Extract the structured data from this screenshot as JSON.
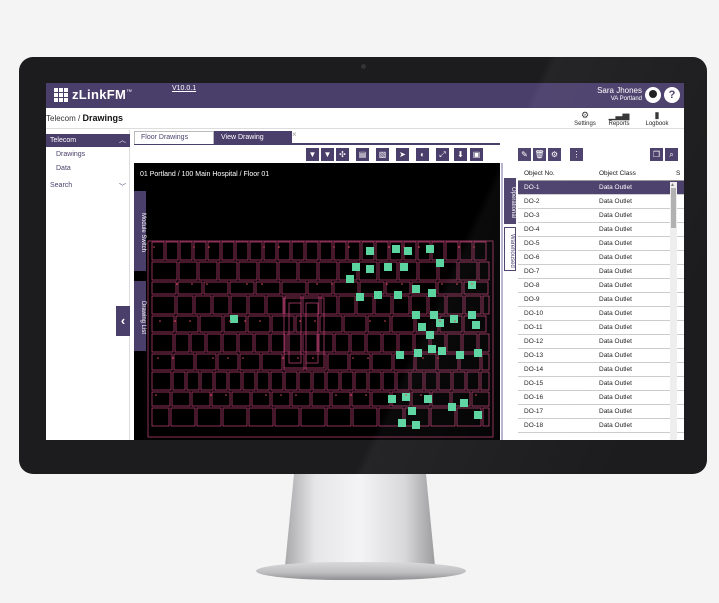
{
  "app": {
    "name": "zLinkFM",
    "trademark": "™",
    "version": "V10.0.1"
  },
  "user": {
    "name": "Sara Jhones",
    "location": "VA Portland",
    "help_glyph": "?"
  },
  "breadcrumb": {
    "parent": "Telecom",
    "separator": " / ",
    "current": "Drawings"
  },
  "toolbar": {
    "settings_label": "Settings",
    "reports_label": "Reports",
    "logbook_label": "Logbook"
  },
  "sidebar": {
    "section": "Telecom",
    "items": [
      {
        "label": "Drawings"
      },
      {
        "label": "Data"
      }
    ],
    "search_label": "Search"
  },
  "tabs": [
    {
      "label": "Floor Drawings"
    },
    {
      "label": "View Drawing"
    }
  ],
  "drawing": {
    "title": "01 Portland / 100 Main Hospital / Floor 01",
    "side_tab_1": "Module Switch",
    "side_tab_2": "Drawing List",
    "colors": {
      "background": "#000000",
      "walls": "#c8437a",
      "outlets": "#5bd4a0"
    }
  },
  "right_panel": {
    "vtab_operational": "Operational",
    "vtab_warehoused": "Warehoused",
    "columns": [
      "Object No.",
      "Object Class",
      "S"
    ],
    "rows": [
      {
        "no": "DO-1",
        "cls": "Data Outlet"
      },
      {
        "no": "DO-2",
        "cls": "Data Outlet"
      },
      {
        "no": "DO-3",
        "cls": "Data Outlet"
      },
      {
        "no": "DO-4",
        "cls": "Data Outlet"
      },
      {
        "no": "DO-5",
        "cls": "Data Outlet"
      },
      {
        "no": "DO-6",
        "cls": "Data Outlet"
      },
      {
        "no": "DO-7",
        "cls": "Data Outlet"
      },
      {
        "no": "DO-8",
        "cls": "Data Outlet"
      },
      {
        "no": "DO-9",
        "cls": "Data Outlet"
      },
      {
        "no": "DO-10",
        "cls": "Data Outlet"
      },
      {
        "no": "DO-11",
        "cls": "Data Outlet"
      },
      {
        "no": "DO-12",
        "cls": "Data Outlet"
      },
      {
        "no": "DO-13",
        "cls": "Data Outlet"
      },
      {
        "no": "DO-14",
        "cls": "Data Outlet"
      },
      {
        "no": "DO-15",
        "cls": "Data Outlet"
      },
      {
        "no": "DO-16",
        "cls": "Data Outlet"
      },
      {
        "no": "DO-17",
        "cls": "Data Outlet"
      },
      {
        "no": "DO-18",
        "cls": "Data Outlet"
      }
    ]
  },
  "theme": {
    "accent": "#4a3f6b"
  }
}
